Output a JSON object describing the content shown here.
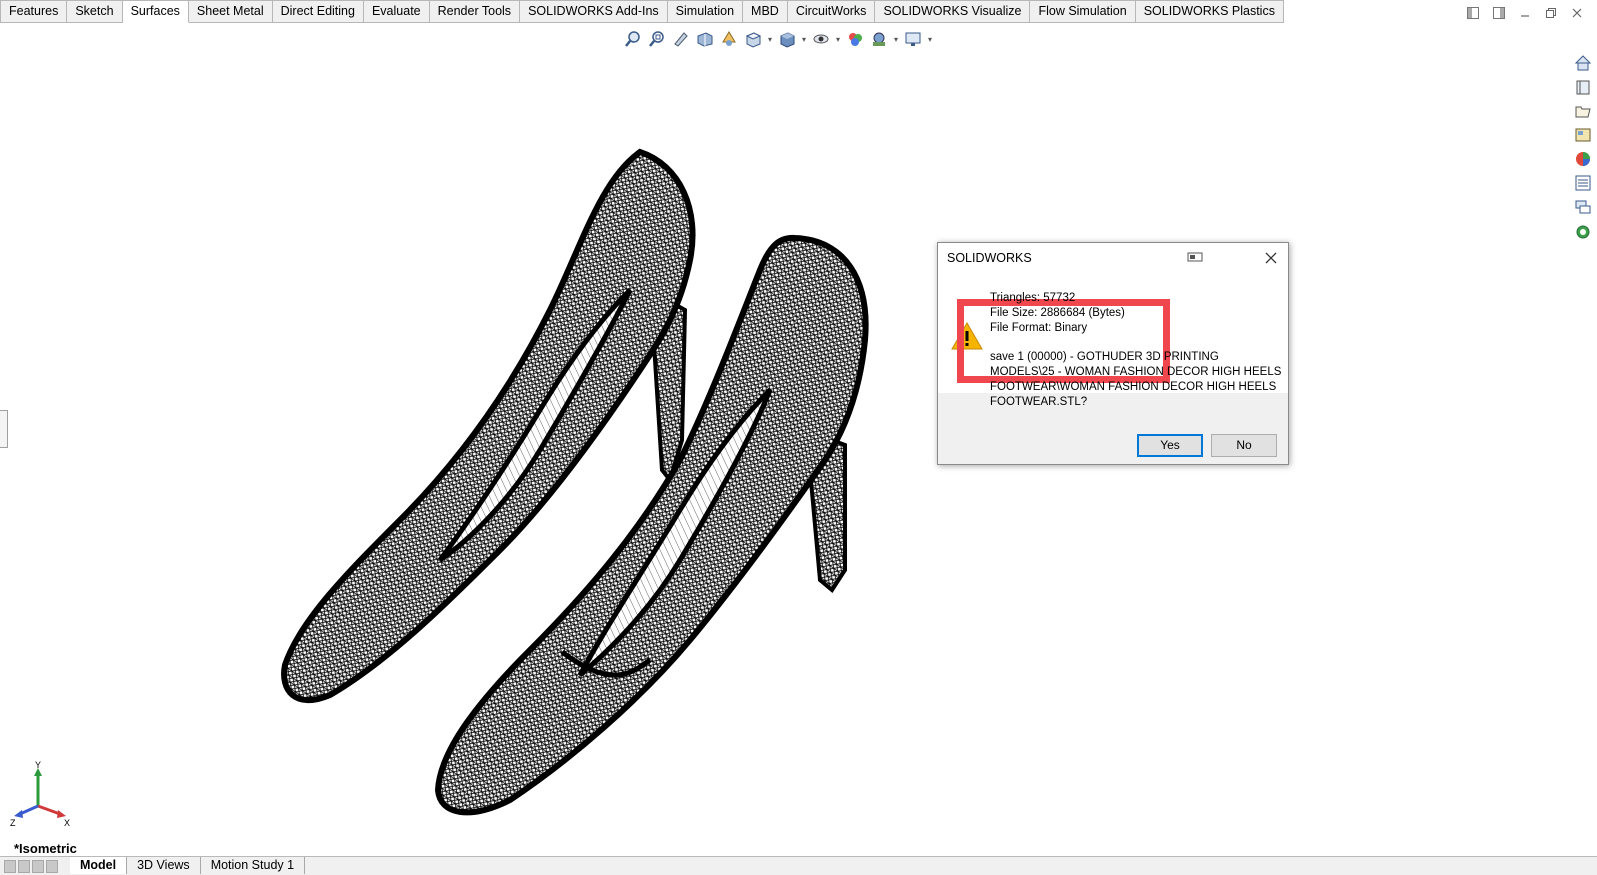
{
  "tabs": [
    {
      "label": "Features",
      "active": false
    },
    {
      "label": "Sketch",
      "active": false
    },
    {
      "label": "Surfaces",
      "active": true
    },
    {
      "label": "Sheet Metal",
      "active": false
    },
    {
      "label": "Direct Editing",
      "active": false
    },
    {
      "label": "Evaluate",
      "active": false
    },
    {
      "label": "Render Tools",
      "active": false
    },
    {
      "label": "SOLIDWORKS Add-Ins",
      "active": false
    },
    {
      "label": "Simulation",
      "active": false
    },
    {
      "label": "MBD",
      "active": false
    },
    {
      "label": "CircuitWorks",
      "active": false
    },
    {
      "label": "SOLIDWORKS Visualize",
      "active": false
    },
    {
      "label": "Flow Simulation",
      "active": false
    },
    {
      "label": "SOLIDWORKS Plastics",
      "active": false
    }
  ],
  "hud_toolbar": [
    "zoom-to-fit-icon",
    "zoom-to-area-icon",
    "previous-view-icon",
    "section-view-icon",
    "dynamic-annotation-icon",
    "view-orientation-icon",
    "display-style-icon",
    "hide-show-icon",
    "edit-appearance-icon",
    "apply-scene-icon",
    "view-settings-icon"
  ],
  "task_pane": [
    "home-icon",
    "resources-icon",
    "design-library-icon",
    "file-explorer-icon",
    "appearances-icon",
    "custom-properties-icon",
    "forum-icon",
    "solidworks-3dexp-icon"
  ],
  "dialog": {
    "title": "SOLIDWORKS",
    "triangles": "Triangles: 57732",
    "file_size": "File Size: 2886684 (Bytes)",
    "file_format": "File Format: Binary",
    "question_line1": "save 1 (00000) - GOTHUDER 3D PRINTING",
    "question_line2": "MODELS\\25 - WOMAN FASHION DECOR HIGH HEELS",
    "question_line3": "FOOTWEAR\\WOMAN FASHION DECOR HIGH HEELS",
    "question_line4": "FOOTWEAR.STL?",
    "yes_label": "Yes",
    "no_label": "No"
  },
  "view_label": "*Isometric",
  "triad": {
    "x": "X",
    "y": "Y",
    "z": "Z"
  },
  "bottom_tabs": [
    {
      "label": "Model",
      "active": true
    },
    {
      "label": "3D Views",
      "active": false
    },
    {
      "label": "Motion Study 1",
      "active": false
    }
  ],
  "colors": {
    "highlight": "#f0464d",
    "accent": "#0078d7",
    "warning": "#f4b400"
  }
}
